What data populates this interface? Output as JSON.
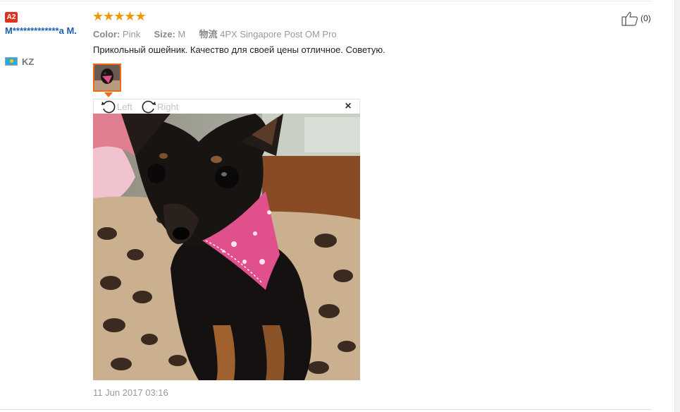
{
  "review": {
    "badge": "A2",
    "user_name": "M*************a M.",
    "country_code": "KZ",
    "country_flag_icon": "kazakhstan-flag-icon",
    "rating": 5,
    "rating_color": "#f39800",
    "attributes": [
      {
        "key": "Color:",
        "value": "Pink"
      },
      {
        "key": "Size:",
        "value": "M"
      },
      {
        "key": "物流",
        "value": "4PX Singapore Post OM Pro"
      }
    ],
    "text": "Прикольный ошейник. Качество для своей цены отличное. Советую.",
    "date": "11 Jun 2017 03:16",
    "helpful_count": "(0)",
    "helpful_icon": "thumbs-up-icon"
  },
  "viewer": {
    "rotate_left_label": "Left",
    "rotate_right_label": "Right",
    "close_label": "×",
    "image_subject": "black chihuahua wearing pink paisley bandana on leopard print blanket"
  },
  "colors": {
    "link": "#1a5fb4",
    "badge": "#e0311f",
    "thumb_border": "#f06a1b",
    "muted": "#999999"
  }
}
